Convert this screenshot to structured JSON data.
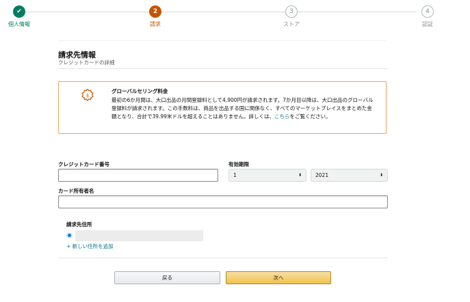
{
  "stepper": {
    "steps": [
      {
        "number": "",
        "label": "個人情報",
        "state": "done"
      },
      {
        "number": "2",
        "label": "請求",
        "state": "current"
      },
      {
        "number": "3",
        "label": "ストア",
        "state": "pending"
      },
      {
        "number": "4",
        "label": "認証",
        "state": "pending"
      }
    ],
    "check_glyph": "✔"
  },
  "page": {
    "title": "請求先情報",
    "subtitle": "クレジットカードの詳細"
  },
  "alert": {
    "icon": "gear-badge-icon",
    "title": "グローバルセリング料金",
    "body": "最初の6か月間は、大口出品の月間登録料として4,900円が請求されます。7か月目以降は、大口出品のグローバル登録料が請求されます。この手数料は、商品を出品する国に関係なく、すべてのマーケットプレイスをまとめた金額となり、合計で39.99米ドルを超えることはありません。詳しくは、",
    "link": "こちら",
    "body_end": "をご覧ください。"
  },
  "form": {
    "card_number_label": "クレジットカード番号",
    "card_number_value": "",
    "expiry_label": "有効期限",
    "expiry_month": "1",
    "expiry_year": "2021",
    "select_arrow": "⬍",
    "cardholder_label": "カード所有者名",
    "cardholder_value": ""
  },
  "billing_address": {
    "label": "請求先住所",
    "add_link": "+ 新しい住所を追加"
  },
  "buttons": {
    "back": "戻る",
    "next": "次へ"
  },
  "colors": {
    "done": "#067d62",
    "current": "#c45500",
    "alert_border": "#f0a35c",
    "link": "#007185",
    "primary_button": "#f0c14b"
  }
}
